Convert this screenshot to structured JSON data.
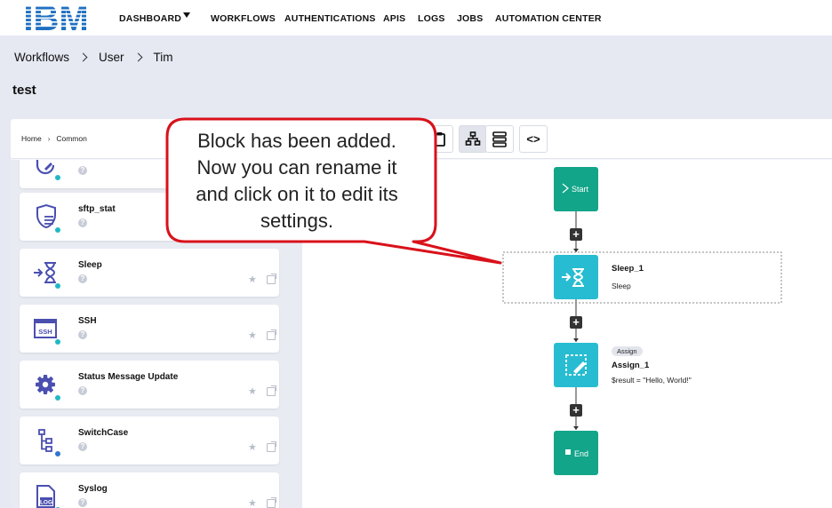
{
  "nav": {
    "logo_text": "IBM",
    "items": [
      "DASHBOARD",
      "WORKFLOWS",
      "AUTHENTICATIONS",
      "APIS",
      "LOGS",
      "JOBS",
      "AUTOMATION CENTER"
    ]
  },
  "breadcrumb": [
    "Workflows",
    "User",
    "Tim"
  ],
  "page_title": "test",
  "sub_breadcrumb": [
    "Home",
    "Common"
  ],
  "blocks": [
    {
      "name": "",
      "icon": "edit-badge-icon",
      "dot": "teal"
    },
    {
      "name": "sftp_stat",
      "icon": "shield-list-icon",
      "dot": "teal"
    },
    {
      "name": "Sleep",
      "icon": "hourglass-arrow-icon",
      "dot": "teal"
    },
    {
      "name": "SSH",
      "icon": "ssh-terminal-icon",
      "dot": "teal"
    },
    {
      "name": "Status Message Update",
      "icon": "gear-icon",
      "dot": "teal"
    },
    {
      "name": "SwitchCase",
      "icon": "switch-tree-icon",
      "dot": "blue"
    },
    {
      "name": "Syslog",
      "icon": "log-file-icon",
      "dot": "teal"
    }
  ],
  "blocks_help_glyph": "?",
  "blocks_favorite_glyph": "★",
  "toolbar": {
    "icons": [
      "clipboard-icon",
      "tree-view-icon",
      "list-view-icon",
      "code-icon"
    ],
    "code_glyph": "<>"
  },
  "flow": {
    "start_label": "Start",
    "end_label": "End",
    "add_glyph": "+",
    "nodes": [
      {
        "title": "Sleep_1",
        "subtitle": "Sleep",
        "tag": ""
      },
      {
        "title": "Assign_1",
        "subtitle": "$result = \"Hello, World!\"",
        "tag": "Assign"
      }
    ]
  },
  "callout": {
    "lines": [
      "Block has been added.",
      "Now you can rename it",
      "and click on it to edit its",
      "settings."
    ]
  },
  "colors": {
    "accent_teal": "#1fb8c6",
    "start_end_green": "#13a589",
    "callout_border": "#d9111a",
    "ibm_blue": "#1f70c1"
  }
}
